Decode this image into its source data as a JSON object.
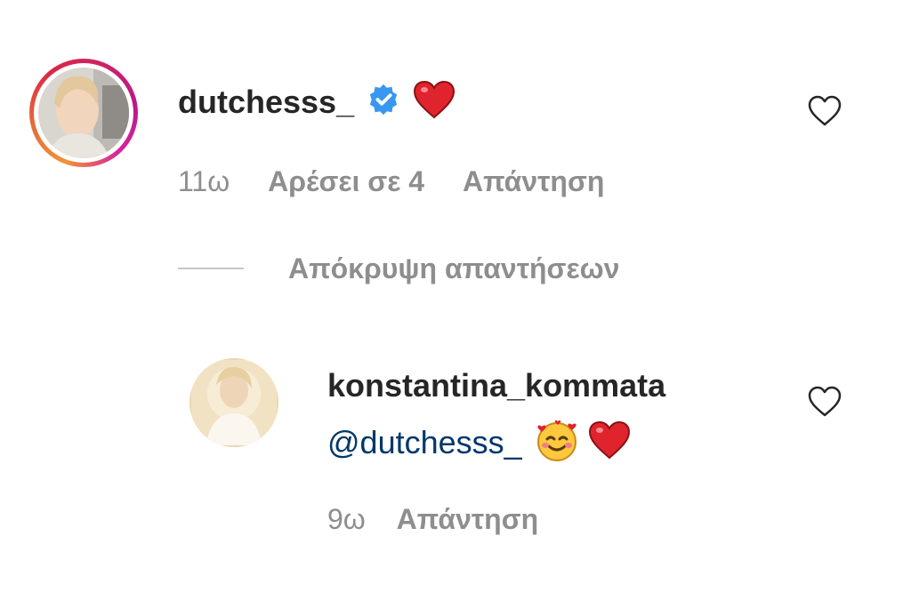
{
  "comment": {
    "username": "dutchesss_",
    "verified_icon": "verified-badge-icon",
    "emoji": "heart-emoji",
    "time": "11ω",
    "likes": "Αρέσει σε 4",
    "reply_label": "Απάντηση"
  },
  "hide_replies_label": "Απόκρυψη απαντήσεων",
  "reply": {
    "username": "konstantina_kommata",
    "mention": "@dutchesss_",
    "emojis": [
      "smiling-face-with-hearts-emoji",
      "heart-emoji"
    ],
    "time": "9ω",
    "reply_label": "Απάντηση"
  },
  "colors": {
    "text": "#262626",
    "meta": "#8e8e8e",
    "mention": "#00376b",
    "verified": "#3897f0",
    "heart": "#e0242d"
  }
}
